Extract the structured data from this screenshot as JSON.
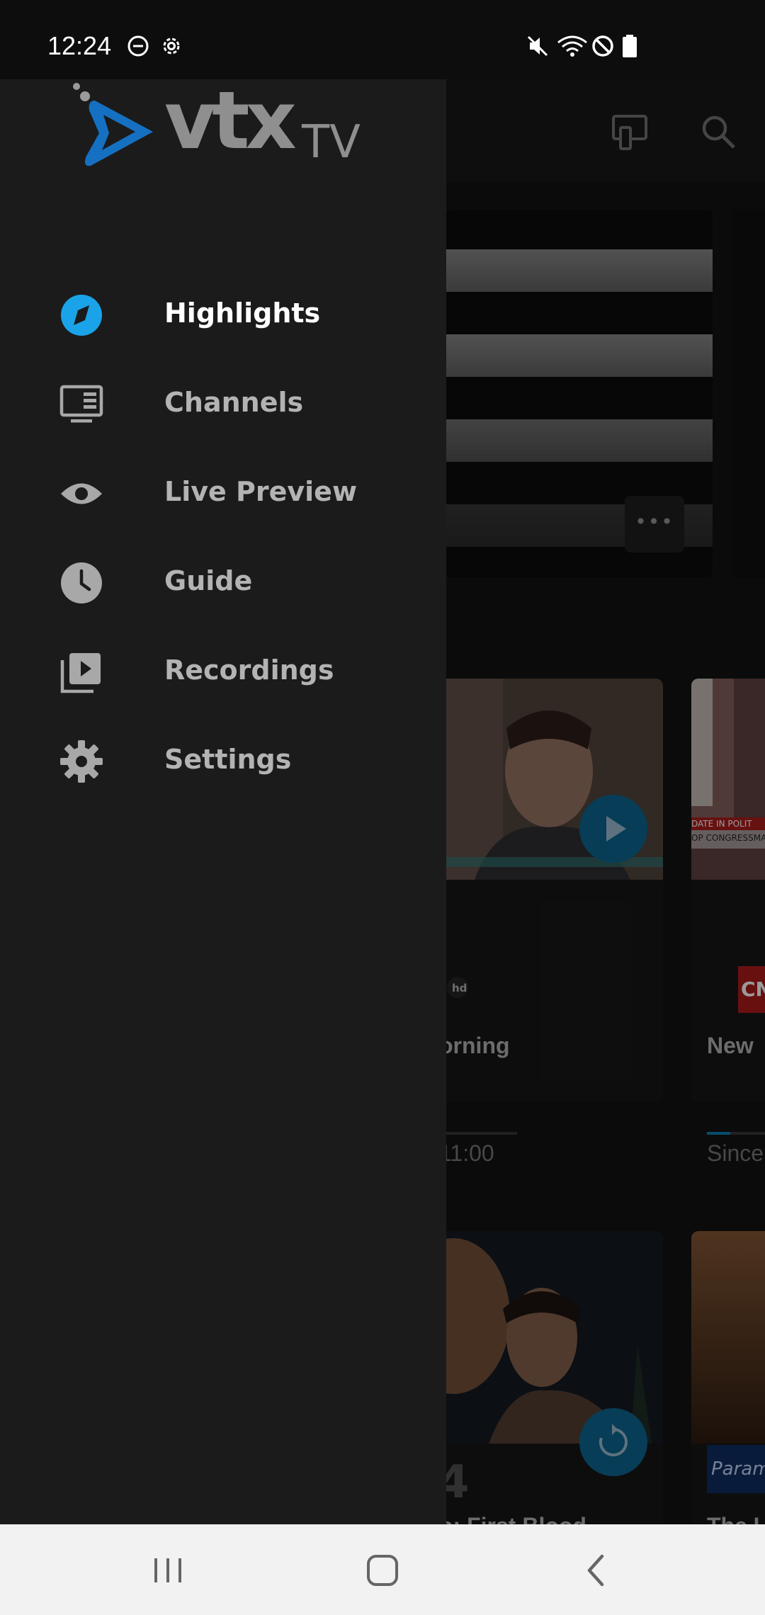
{
  "status_bar": {
    "time": "12:24"
  },
  "app": {
    "name": "vtx",
    "name_suffix": "TV",
    "brand_color": "#1aa3e8"
  },
  "drawer": {
    "items": [
      {
        "label": "Highlights",
        "icon": "compass-icon",
        "active": true
      },
      {
        "label": "Channels",
        "icon": "tv-list-icon",
        "active": false
      },
      {
        "label": "Live Preview",
        "icon": "eye-icon",
        "active": false
      },
      {
        "label": "Guide",
        "icon": "clock-icon",
        "active": false
      },
      {
        "label": "Recordings",
        "icon": "play-library-icon",
        "active": false
      },
      {
        "label": "Settings",
        "icon": "gear-icon",
        "active": false
      }
    ]
  },
  "background": {
    "live_badge": "hd",
    "cards": [
      {
        "title": "orning",
        "sub": "11:00",
        "progress": 0.1
      },
      {
        "title": "New",
        "sub": "Since",
        "progress": 0.2
      },
      {
        "title": "o: First Blood",
        "overlay": "4"
      },
      {
        "title": "The U"
      }
    ],
    "ticker_text": "DATE IN POLIT",
    "ticker_text_2": "OP CONGRESSMAN",
    "cnn_logo": "CNN",
    "paramount_logo": "Param"
  }
}
